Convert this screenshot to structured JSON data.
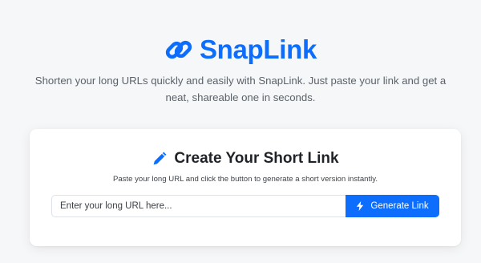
{
  "brand": {
    "name": "SnapLink",
    "icon": "link-icon",
    "color": "#0d6efd"
  },
  "tagline": "Shorten your long URLs quickly and easily with SnapLink. Just paste your link and get a neat, shareable one in seconds.",
  "card": {
    "icon": "pencil-icon",
    "title": "Create Your Short Link",
    "subtitle": "Paste your long URL and click the button to generate a short version instantly.",
    "input": {
      "value": "",
      "placeholder": "Enter your long URL here..."
    },
    "button": {
      "icon": "lightning-icon",
      "label": "Generate Link"
    }
  },
  "colors": {
    "accent": "#0d6efd",
    "background": "#f6f7f9"
  }
}
